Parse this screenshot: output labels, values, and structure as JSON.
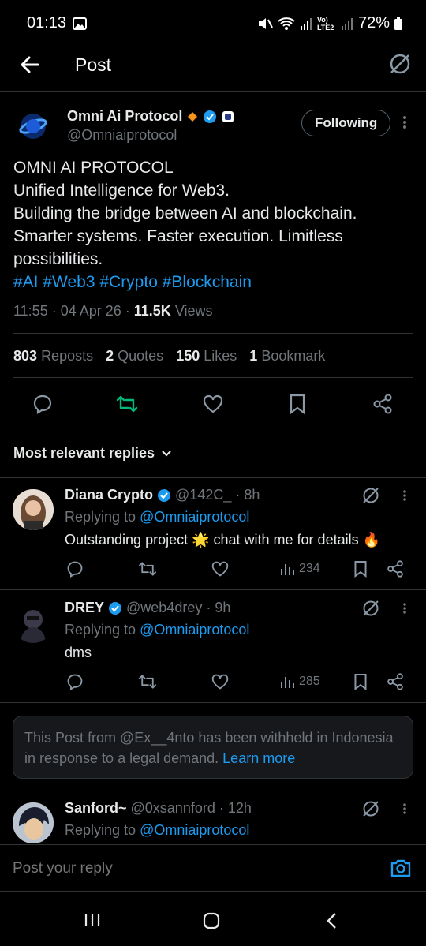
{
  "status_bar": {
    "time": "01:13",
    "battery": "72%",
    "network": "Vo) LTE2"
  },
  "header": {
    "title": "Post"
  },
  "post": {
    "author_name": "Omni Ai Protocol",
    "author_handle": "@Omniaiprotocol",
    "follow_label": "Following",
    "lines": [
      "OMNI AI PROTOCOL",
      "Unified Intelligence for Web3.",
      "Building the bridge between AI and blockchain.",
      "Smarter systems. Faster execution. Limitless",
      "possibilities."
    ],
    "hashtags": "#AI #Web3 #Crypto #Blockchain",
    "time": "11:55 · 04 Apr 26 · ",
    "views_count": "11.5K",
    "views_label": " Views",
    "stats": {
      "reposts_count": "803",
      "reposts_label": "Reposts",
      "quotes_count": "2",
      "quotes_label": "Quotes",
      "likes_count": "150",
      "likes_label": "Likes",
      "bookmarks_count": "1",
      "bookmarks_label": "Bookmark"
    },
    "accent_repost": "#00ba7c"
  },
  "replies_filter": {
    "label": "Most relevant replies"
  },
  "replies": [
    {
      "name": "Diana Crypto",
      "handle": "@142C_",
      "time": "· 8h",
      "replying_prefix": "Replying to ",
      "replying_to": "@Omniaiprotocol",
      "text": "Outstanding project 🌟 chat with me for details 🔥",
      "views": "234"
    },
    {
      "name": "DREY",
      "handle": "@web4drey",
      "time": "· 9h",
      "replying_prefix": "Replying to ",
      "replying_to": "@Omniaiprotocol",
      "text": "dms",
      "views": "285"
    },
    {
      "name": "Sanford~",
      "handle": "@0xsannford",
      "time": "· 12h",
      "replying_prefix": "Replying to ",
      "replying_to": "@Omniaiprotocol"
    }
  ],
  "withheld": {
    "text": "This Post from @Ex__4nto has been withheld in Indonesia in response to a legal demand. ",
    "link": "Learn more"
  },
  "composer": {
    "placeholder": "Post your reply"
  },
  "colors": {
    "background": "#000000",
    "link": "#1d9bf0",
    "verified": "#1d9bf0",
    "muted": "#71767b"
  }
}
